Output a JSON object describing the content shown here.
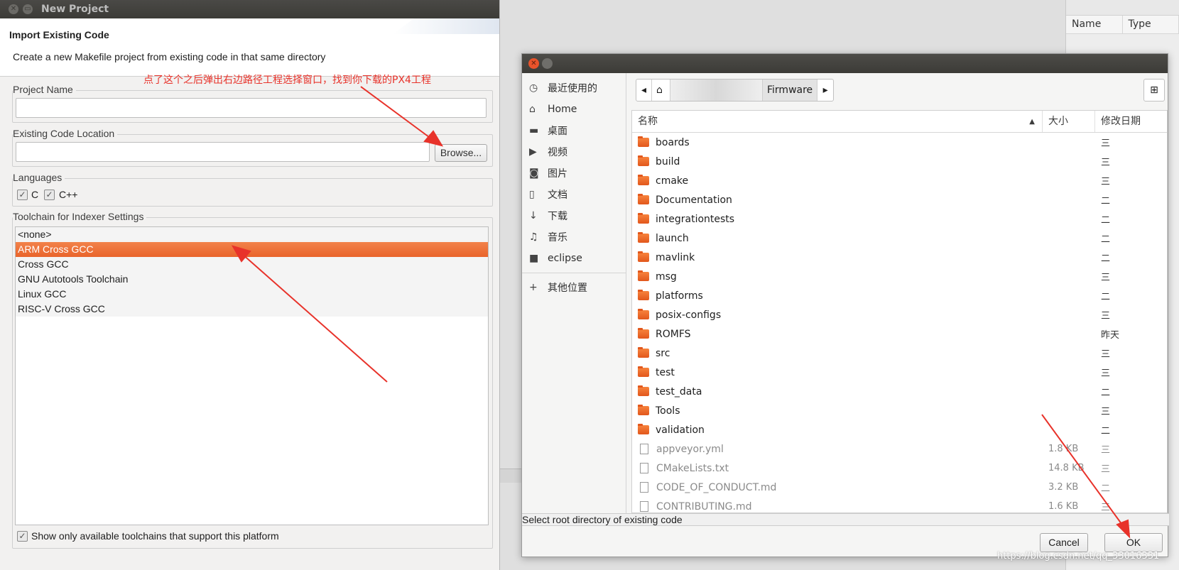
{
  "new_project": {
    "window_title": "New Project",
    "header_title": "Import Existing Code",
    "header_desc": "Create a new Makefile project from existing code in that same directory",
    "project_name_label": "Project Name",
    "project_name_value": "",
    "existing_code_label": "Existing Code Location",
    "existing_code_value": "",
    "browse_label": "Browse...",
    "languages_label": "Languages",
    "lang_c": "C",
    "lang_cpp": "C++",
    "toolchain_label": "Toolchain for Indexer Settings",
    "toolchains": [
      "<none>",
      "ARM Cross GCC",
      "Cross GCC",
      "GNU Autotools Toolchain",
      "Linux GCC",
      "RISC-V Cross GCC"
    ],
    "selected_toolchain": "ARM Cross GCC",
    "show_only_label": "Show only available toolchains that support this platform"
  },
  "annotation": "点了这个之后弹出右边路径工程选择窗口，找到你下载的PX4工程",
  "file_chooser": {
    "sidebar": [
      {
        "icon": "recent-icon",
        "label": "最近使用的"
      },
      {
        "icon": "home-icon",
        "label": "Home"
      },
      {
        "icon": "desktop-folder-icon",
        "label": "桌面"
      },
      {
        "icon": "videos-icon",
        "label": "视频"
      },
      {
        "icon": "pictures-icon",
        "label": "图片"
      },
      {
        "icon": "documents-icon",
        "label": "文档"
      },
      {
        "icon": "downloads-icon",
        "label": "下载"
      },
      {
        "icon": "music-icon",
        "label": "音乐"
      },
      {
        "icon": "folder-icon",
        "label": "eclipse"
      }
    ],
    "other_locations": "其他位置",
    "path_current": "Firmware",
    "columns": {
      "name": "名称",
      "size": "大小",
      "modified": "修改日期"
    },
    "rows": [
      {
        "type": "folder",
        "name": "boards",
        "size": "",
        "date": "三"
      },
      {
        "type": "folder",
        "name": "build",
        "size": "",
        "date": "三"
      },
      {
        "type": "folder",
        "name": "cmake",
        "size": "",
        "date": "三"
      },
      {
        "type": "folder",
        "name": "Documentation",
        "size": "",
        "date": "二"
      },
      {
        "type": "folder",
        "name": "integrationtests",
        "size": "",
        "date": "二"
      },
      {
        "type": "folder",
        "name": "launch",
        "size": "",
        "date": "二"
      },
      {
        "type": "folder",
        "name": "mavlink",
        "size": "",
        "date": "二"
      },
      {
        "type": "folder",
        "name": "msg",
        "size": "",
        "date": "三"
      },
      {
        "type": "folder",
        "name": "platforms",
        "size": "",
        "date": "二"
      },
      {
        "type": "folder",
        "name": "posix-configs",
        "size": "",
        "date": "三"
      },
      {
        "type": "folder",
        "name": "ROMFS",
        "size": "",
        "date": "昨天"
      },
      {
        "type": "folder",
        "name": "src",
        "size": "",
        "date": "三"
      },
      {
        "type": "folder",
        "name": "test",
        "size": "",
        "date": "三"
      },
      {
        "type": "folder",
        "name": "test_data",
        "size": "",
        "date": "二"
      },
      {
        "type": "folder",
        "name": "Tools",
        "size": "",
        "date": "三"
      },
      {
        "type": "folder",
        "name": "validation",
        "size": "",
        "date": "二"
      },
      {
        "type": "file",
        "name": "appveyor.yml",
        "size": "1.8 KB",
        "date": "三"
      },
      {
        "type": "file",
        "name": "CMakeLists.txt",
        "size": "14.8 KB",
        "date": "三"
      },
      {
        "type": "file",
        "name": "CODE_OF_CONDUCT.md",
        "size": "3.2 KB",
        "date": "二"
      },
      {
        "type": "file",
        "name": "CONTRIBUTING.md",
        "size": "1.6 KB",
        "date": "三"
      }
    ],
    "status": "Select root directory of existing code",
    "cancel_label": "Cancel",
    "ok_label": "OK"
  },
  "background": {
    "col_name": "Name",
    "col_type": "Type"
  },
  "watermark": "https://blog.csdn.net/qq_33016331",
  "colors": {
    "selection_orange": "#e9642b",
    "annotation_red": "#e8322a"
  }
}
